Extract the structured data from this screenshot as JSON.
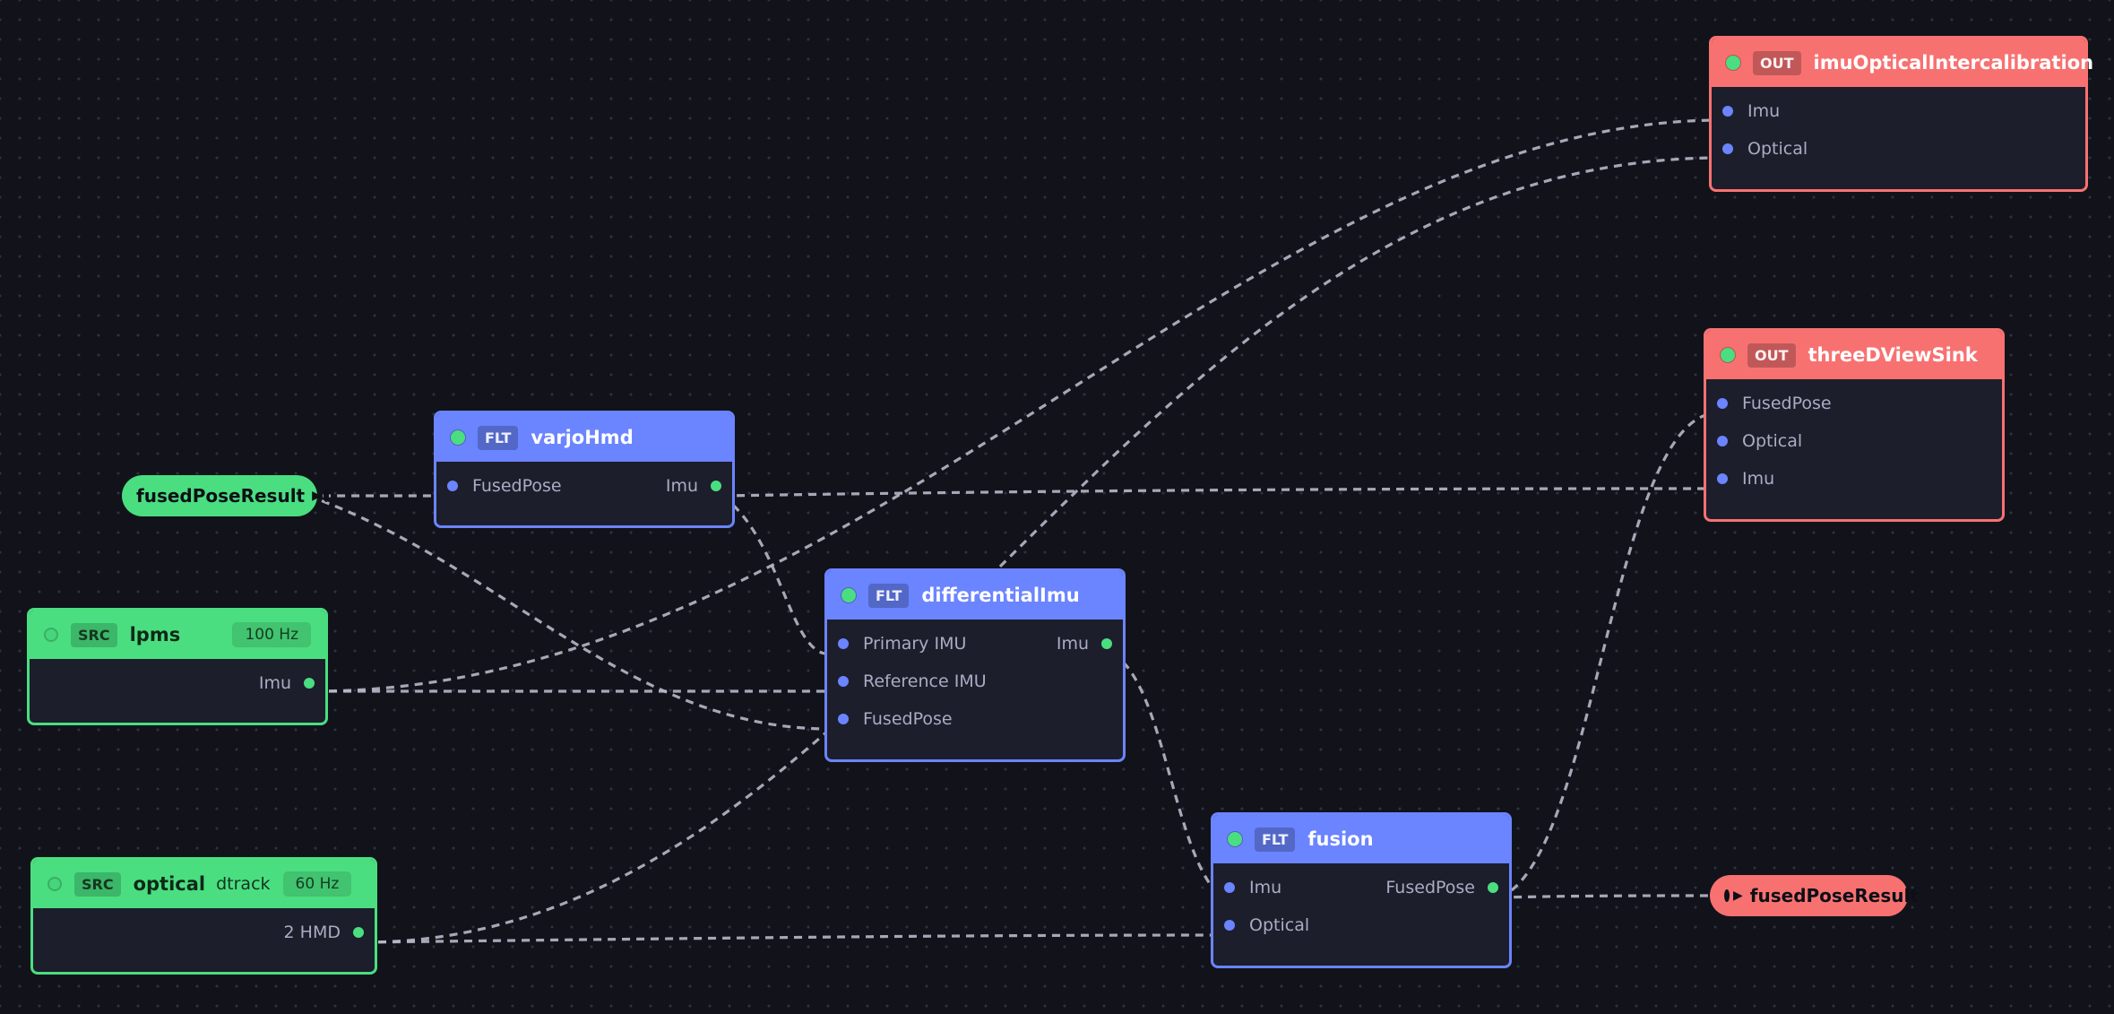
{
  "colors": {
    "source": "#4ade80",
    "filter": "#6b84ff",
    "output": "#f87171",
    "canvas": "#12131a",
    "edge": "#b7b9c9"
  },
  "nodes": {
    "lpms": {
      "kind": "SRC",
      "title": "lpms",
      "rate": "100 Hz",
      "active": false,
      "outputs": [
        "Imu"
      ]
    },
    "optical": {
      "kind": "SRC",
      "title": "optical",
      "subtitle": "dtrack",
      "rate": "60 Hz",
      "active": false,
      "outputs": [
        "2 HMD"
      ]
    },
    "varjoHmd": {
      "kind": "FLT",
      "title": "varjoHmd",
      "active": true,
      "inputs": [
        "FusedPose"
      ],
      "outputs": [
        "Imu"
      ]
    },
    "differentialImu": {
      "kind": "FLT",
      "title": "differentialImu",
      "active": true,
      "inputs": [
        "Primary IMU",
        "Reference IMU",
        "FusedPose"
      ],
      "outputs": [
        "Imu"
      ]
    },
    "fusion": {
      "kind": "FLT",
      "title": "fusion",
      "active": true,
      "inputs": [
        "Imu",
        "Optical"
      ],
      "outputs": [
        "FusedPose"
      ]
    },
    "imuOpticalIntercalibration": {
      "kind": "OUT",
      "title": "imuOpticalIntercalibration",
      "active": true,
      "inputs": [
        "Imu",
        "Optical"
      ]
    },
    "threeDViewSink": {
      "kind": "OUT",
      "title": "threeDViewSink",
      "active": true,
      "inputs": [
        "FusedPose",
        "Optical",
        "Imu"
      ]
    }
  },
  "terminals": {
    "input_pill": {
      "label": "fusedPoseResult",
      "icon": "play-arrow-icon"
    },
    "output_pill": {
      "label": "fusedPoseResult",
      "icon": "play-arrow-icon"
    }
  }
}
